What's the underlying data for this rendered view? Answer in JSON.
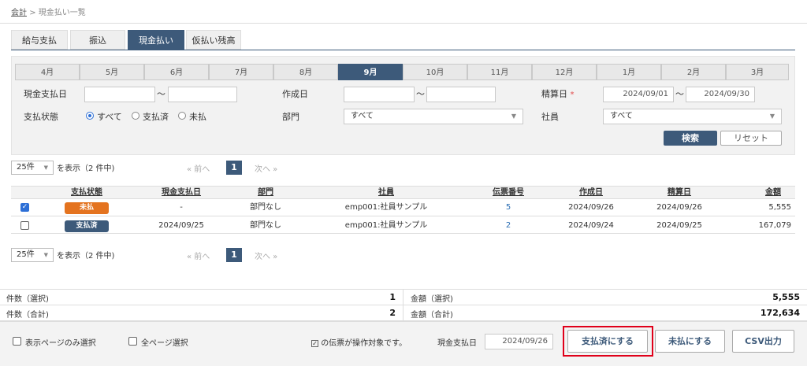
{
  "breadcrumb": {
    "root": "会計",
    "sep": ">",
    "current": "現金払い一覧"
  },
  "tabs": [
    {
      "label": "給与支払"
    },
    {
      "label": "振込"
    },
    {
      "label": "現金払い"
    },
    {
      "label": "仮払い残高"
    }
  ],
  "active_tab": "現金払い",
  "months": [
    "4月",
    "5月",
    "6月",
    "7月",
    "8月",
    "9月",
    "10月",
    "11月",
    "12月",
    "1月",
    "2月",
    "3月"
  ],
  "active_month": "9月",
  "filters": {
    "cash_date_label": "現金支払日",
    "cash_date_from": "",
    "cash_date_to": "",
    "tilde": "〜",
    "created_label": "作成日",
    "created_from": "",
    "created_to": "",
    "settle_label": "精算日",
    "required_mark": "*",
    "settle_from": "2024/09/01",
    "settle_to": "2024/09/30",
    "status_label": "支払状態",
    "status_options": [
      "すべて",
      "支払済",
      "未払"
    ],
    "status_selected": "すべて",
    "dept_label": "部門",
    "dept_value": "すべて",
    "employee_label": "社員",
    "employee_value": "すべて",
    "search_label": "検索",
    "reset_label": "リセット"
  },
  "pager": {
    "per_page": "25件",
    "summary": "を表示（2 件中)",
    "prev": "« 前へ",
    "page": "1",
    "next": "次へ »"
  },
  "table": {
    "columns": [
      "支払状態",
      "現金支払日",
      "部門",
      "社員",
      "伝票番号",
      "作成日",
      "精算日",
      "金額"
    ],
    "rows": [
      {
        "checked": true,
        "status": "未払",
        "status_color": "#e4731f",
        "cash_date": "-",
        "dept": "部門なし",
        "employee": "emp001:社員サンプル",
        "slip": "5",
        "created": "2024/09/26",
        "settled": "2024/09/26",
        "amount": "5,555"
      },
      {
        "checked": false,
        "status": "支払済",
        "status_color": "#3d5a7a",
        "cash_date": "2024/09/25",
        "dept": "部門なし",
        "employee": "emp001:社員サンプル",
        "slip": "2",
        "created": "2024/09/24",
        "settled": "2024/09/25",
        "amount": "167,079"
      }
    ]
  },
  "summary": {
    "count_selected_label": "件数（選択)",
    "count_selected": "1",
    "amount_selected_label": "金額（選択)",
    "amount_selected": "5,555",
    "count_total_label": "件数（合計)",
    "count_total": "2",
    "amount_total_label": "金額（合計)",
    "amount_total": "172,634"
  },
  "footer": {
    "page_only_label": "表示ページのみ選択",
    "all_pages_label": "全ページ選択",
    "target_note": "の伝票が操作対象です。",
    "cash_date_label": "現金支払日",
    "cash_date_value": "2024/09/26",
    "mark_paid_label": "支払済にする",
    "mark_unpaid_label": "未払にする",
    "csv_label": "CSV出力"
  },
  "colors": {
    "accent": "#3d5a7a",
    "unpaid": "#e4731f",
    "highlight": "#e0001a"
  }
}
